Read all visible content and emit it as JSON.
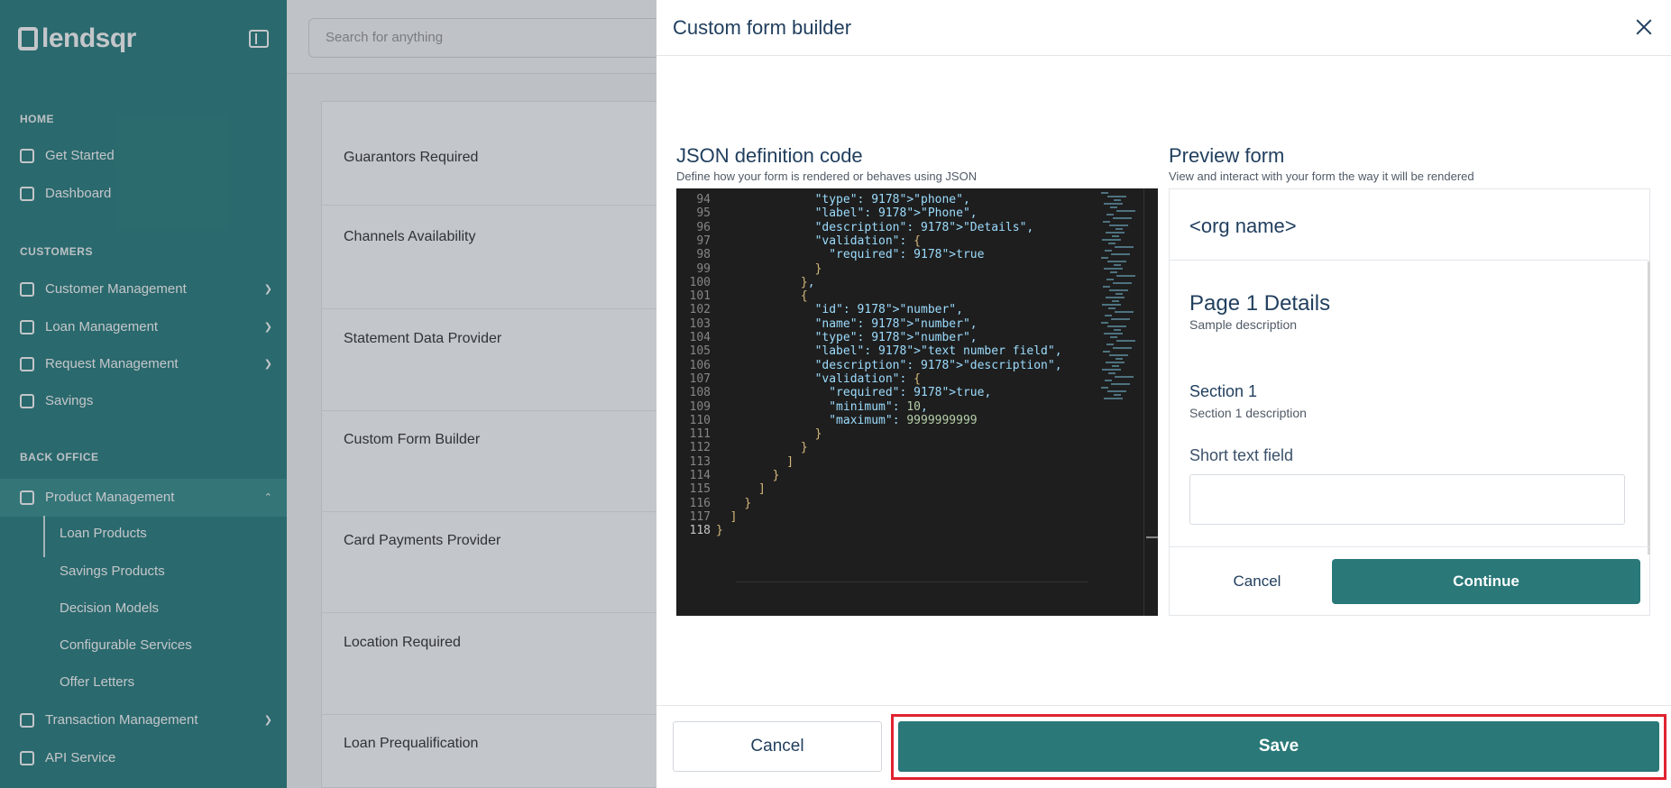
{
  "sidebar": {
    "brand": "lendsqr",
    "sections": {
      "home": "HOME",
      "customers": "CUSTOMERS",
      "back_office": "BACK OFFICE"
    },
    "items": {
      "get_started": "Get Started",
      "dashboard": "Dashboard",
      "customer_management": "Customer Management",
      "loan_management": "Loan Management",
      "request_management": "Request Management",
      "savings": "Savings",
      "product_management": "Product Management",
      "transaction_management": "Transaction Management",
      "api_service": "API Service"
    },
    "sub_items": {
      "loan_products": "Loan Products",
      "savings_products": "Savings Products",
      "decision_models": "Decision Models",
      "configurable_services": "Configurable Services",
      "offer_letters": "Offer Letters"
    }
  },
  "topbar": {
    "search_placeholder": "Search for anything"
  },
  "settings": {
    "rows": [
      "Guarantors Required",
      "Channels Availability",
      "Statement Data Provider",
      "Custom Form Builder",
      "Card Payments Provider",
      "Location Required",
      "Loan Prequalification"
    ]
  },
  "modal": {
    "title": "Custom form builder",
    "json_panel": {
      "title": "JSON definition code",
      "subtitle": "Define how your form is rendered or behaves using JSON"
    },
    "preview_panel": {
      "title": "Preview form",
      "subtitle": "View and interact with your form the way it will be rendered",
      "org_name": "<org name>",
      "page_title": "Page 1 Details",
      "page_description": "Sample description",
      "section_title": "Section 1",
      "section_description": "Section 1 description",
      "field_label": "Short text field",
      "field_value": "",
      "cancel_label": "Cancel",
      "continue_label": "Continue"
    },
    "footer": {
      "cancel_label": "Cancel",
      "save_label": "Save"
    }
  },
  "code_lines": [
    {
      "n": "94",
      "t": "              \"type\": \"phone\","
    },
    {
      "n": "95",
      "t": "              \"label\": \"Phone\","
    },
    {
      "n": "96",
      "t": "              \"description\": \"Details\","
    },
    {
      "n": "97",
      "t": "              \"validation\": {"
    },
    {
      "n": "98",
      "t": "                \"required\": true"
    },
    {
      "n": "99",
      "t": "              }"
    },
    {
      "n": "100",
      "t": "            },"
    },
    {
      "n": "101",
      "t": "            {"
    },
    {
      "n": "102",
      "t": "              \"id\": \"number\","
    },
    {
      "n": "103",
      "t": "              \"name\": \"number\","
    },
    {
      "n": "104",
      "t": "              \"type\": \"number\","
    },
    {
      "n": "105",
      "t": "              \"label\": \"text number field\","
    },
    {
      "n": "106",
      "t": "              \"description\": \"description\","
    },
    {
      "n": "107",
      "t": "              \"validation\": {"
    },
    {
      "n": "108",
      "t": "                \"required\": true,"
    },
    {
      "n": "109",
      "t": "                \"minimum\": 10,"
    },
    {
      "n": "110",
      "t": "                \"maximum\": 9999999999"
    },
    {
      "n": "111",
      "t": "              }"
    },
    {
      "n": "112",
      "t": "            }"
    },
    {
      "n": "113",
      "t": "          ]"
    },
    {
      "n": "114",
      "t": "        }"
    },
    {
      "n": "115",
      "t": "      ]"
    },
    {
      "n": "116",
      "t": "    }"
    },
    {
      "n": "117",
      "t": "  ]"
    },
    {
      "n": "118",
      "t": "}"
    }
  ],
  "colors": {
    "brand_teal": "#2a7878",
    "sidebar_teal": "#2c7f7e",
    "highlight_red": "#e0232f",
    "editor_bg": "#1e1e1e"
  }
}
